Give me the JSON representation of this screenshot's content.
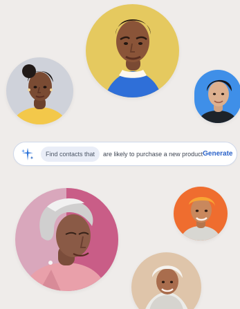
{
  "search_bar": {
    "prefix_label": "Find contacts that",
    "query_text": "are likely to purchase a new product",
    "generate_label": "Generate"
  },
  "avatars": [
    {
      "description": "portrait",
      "background": "#e5c95f"
    },
    {
      "description": "portrait",
      "background": "#cfd2da"
    },
    {
      "description": "portrait",
      "background": "#3f8fe8"
    },
    {
      "description": "portrait",
      "background": "#d9a7bc"
    },
    {
      "description": "portrait",
      "background": "#ef6d2f"
    },
    {
      "description": "portrait",
      "background": "#dfc5aa"
    }
  ],
  "colors": {
    "page_background": "#efecea",
    "accent": "#2a62c9",
    "chip_background": "#e9edf7"
  },
  "icons": {
    "search_bar": "sparkle-icon"
  }
}
